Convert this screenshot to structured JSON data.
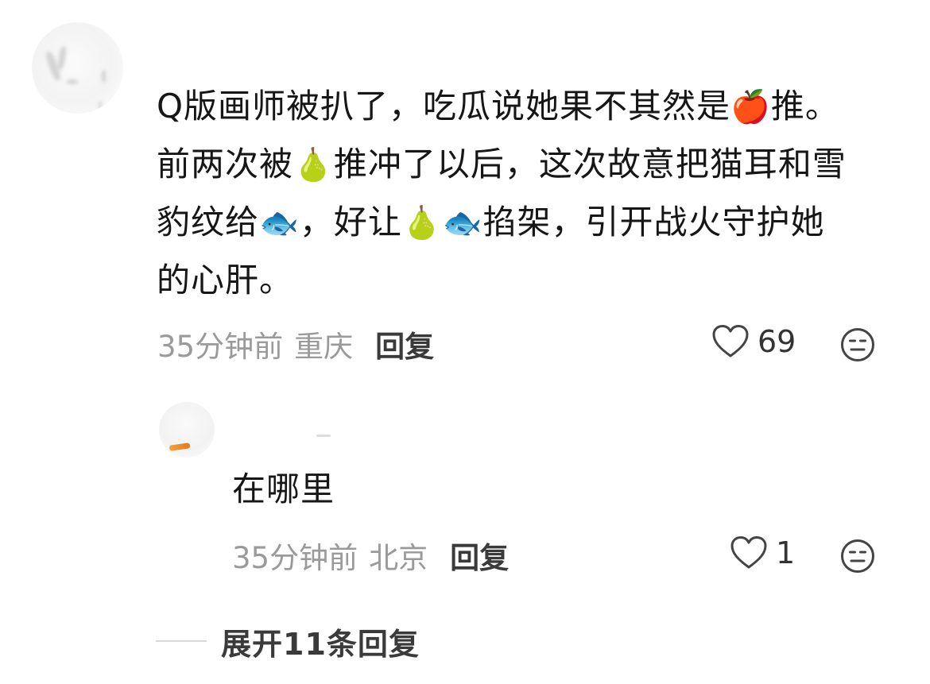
{
  "comment": {
    "lines": [
      [
        "Q版画师被扒了，吃瓜说她果不其然是",
        "🍎",
        "推。"
      ],
      [
        "前两次被",
        "🍐",
        "推冲了以后，这次故意把猫耳和雪"
      ],
      [
        "豹纹给",
        "🐟",
        "，好让",
        "🍐",
        "🐟",
        "掐架，引开战火守护她"
      ],
      [
        "的心肝。"
      ]
    ],
    "time": "35分钟前",
    "location": "重庆",
    "reply_label": "回复",
    "like_count": "69"
  },
  "reply": {
    "text": "在哪里",
    "time": "35分钟前",
    "location": "北京",
    "reply_label": "回复",
    "like_count": "1"
  },
  "expand": {
    "label": "展开11条回复"
  },
  "icons": {
    "like": "heart-outline-icon",
    "react": "meh-face-icon"
  },
  "colors": {
    "meta_text": "#9a9a9a",
    "icon_stroke": "#444444"
  }
}
